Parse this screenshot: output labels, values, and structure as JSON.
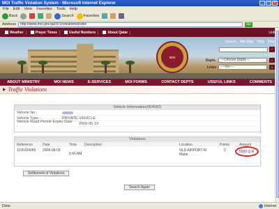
{
  "window": {
    "title": "MOI Traffic Violation System - Microsoft Internet Explorer"
  },
  "menubar": [
    "File",
    "Edit",
    "View",
    "Favorites",
    "Tools",
    "Help"
  ],
  "toolbar": {
    "back": "Back",
    "search": "Search",
    "favorites": "Favorites"
  },
  "address": {
    "label": "Address",
    "url": "http://www.moi.gov.qa/TFV/violations/index",
    "go": "Go"
  },
  "site_nav": {
    "items": [
      "Weather",
      "Prayer Times",
      "Useful Numbers",
      "About Qatar"
    ],
    "right": [
      "Links"
    ]
  },
  "banner": {
    "tools": [
      "Search",
      "Site Map",
      "Help",
      "Email"
    ],
    "depts_label": "Depts.",
    "depts_value": "---Choose Depts---",
    "links_label": "Links",
    "links_value": "----Go----",
    "emblem_text": "STATE OF QATAR MINISTRY OF INTERIOR"
  },
  "mainmenu": [
    "ABOUT MINISTRY",
    "MOI NEWS",
    "E-SERVICES",
    "MOI FORMS",
    "CONTACT DEPTS",
    "USEFUL LINKS",
    "COMMENTS"
  ],
  "page": {
    "title": "Traffic Violations"
  },
  "vehicle_info": {
    "header": "Vehicle Information(064582)",
    "rows": [
      {
        "label": "Vehicle No :",
        "value": ""
      },
      {
        "label": "Vehicle Type :",
        "value": "PRIVATE-VEHICLE"
      },
      {
        "label": "Vehicle Road Permit Expiry Date :",
        "value": "2009-05-10"
      }
    ]
  },
  "violations": {
    "header": "Violations",
    "columns": [
      "Reference",
      "Date",
      "Time",
      "Description",
      "Location",
      "Points",
      "Amount"
    ],
    "rows": [
      {
        "reference": "1100109085",
        "date": "2008-08-09",
        "time": "6:40 AM",
        "description": "",
        "location": "OLD AIRPORT AI Matar",
        "points": "0",
        "amount": "6000 Q.R"
      }
    ]
  },
  "buttons": {
    "settlement": "Settlement of Violations",
    "search_again": "Search Again"
  },
  "status": {
    "left": "Done",
    "zone": "Internet"
  },
  "colors": {
    "accent": "#6b1226",
    "highlight": "#e31a1a"
  }
}
